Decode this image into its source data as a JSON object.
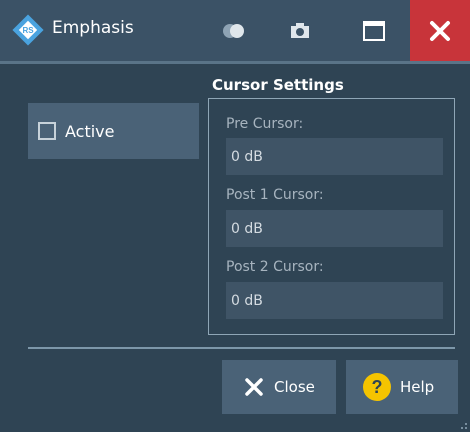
{
  "window": {
    "title": "Emphasis",
    "icons": [
      "rs-logo-icon",
      "toggle-icon",
      "camera-icon",
      "maximize-icon",
      "close-icon"
    ]
  },
  "active_toggle": {
    "label": "Active",
    "checked": false
  },
  "cursor_settings": {
    "title": "Cursor Settings",
    "fields": [
      {
        "label": "Pre Cursor:",
        "value": "0 dB"
      },
      {
        "label": "Post 1 Cursor:",
        "value": "0 dB"
      },
      {
        "label": "Post 2 Cursor:",
        "value": "0 dB"
      }
    ]
  },
  "buttons": {
    "close_label": "Close",
    "help_label": "Help"
  },
  "colors": {
    "background": "#2f4454",
    "titlebar": "#3b5266",
    "close_red": "#c8343a",
    "help_yellow": "#f5c400",
    "logo_blue": "#4aa3df"
  }
}
